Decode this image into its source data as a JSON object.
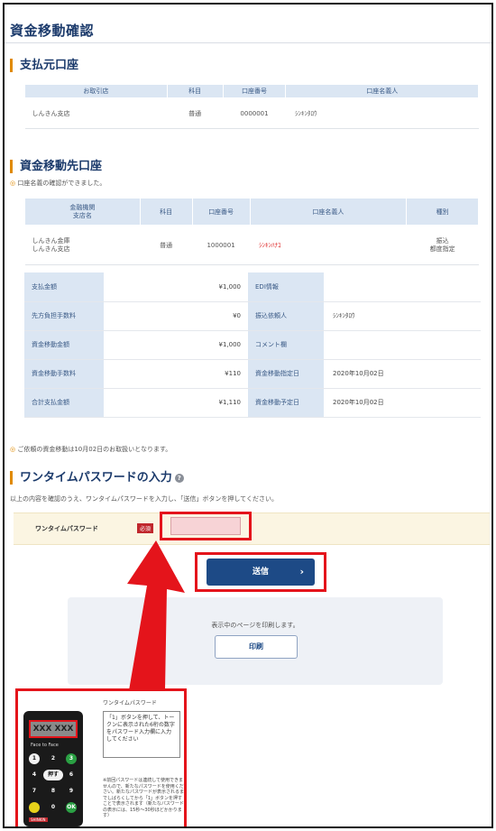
{
  "page": {
    "title": "資金移動確認"
  },
  "source": {
    "title": "支払元口座",
    "headers": [
      "お取引店",
      "科目",
      "口座番号",
      "口座名義人"
    ],
    "row": [
      "しんきん支店",
      "普通",
      "0000001",
      "ｼﾝｷﾝﾀﾛｳ"
    ]
  },
  "dest": {
    "title": "資金移動先口座",
    "notice": "口座名義の確認ができました。",
    "headers": [
      "金融機関\n支店名",
      "科目",
      "口座番号",
      "口座名義人",
      "種別"
    ],
    "row": {
      "bank": "しんきん金庫",
      "branch": "しんきん支店",
      "type": "普通",
      "number": "1000001",
      "name": "ｼﾝｷﾝﾊﾅｺ",
      "kind1": "振込",
      "kind2": "都度指定"
    }
  },
  "amounts": [
    {
      "label": "支払金額",
      "value": "¥1,000",
      "label2": "EDI情報",
      "value2": ""
    },
    {
      "label": "先方負担手数料",
      "value": "¥0",
      "label2": "振込依頼人",
      "value2": "ｼﾝｷﾝﾀﾛｳ"
    },
    {
      "label": "資金移動金額",
      "value": "¥1,000",
      "label2": "コメント欄",
      "value2": ""
    },
    {
      "label": "資金移動手数料",
      "value": "¥110",
      "label2": "資金移動指定日",
      "value2": "2020年10月02日"
    },
    {
      "label": "合計支払金額",
      "value": "¥1,110",
      "label2": "資金移動予定日",
      "value2": "2020年10月02日"
    }
  ],
  "schedule_note": "ご依頼の資金移動は10月02日のお取扱いとなります。",
  "otp": {
    "title": "ワンタイムパスワードの入力",
    "help_icon": "?",
    "instruction": "以上の内容を確認のうえ、ワンタイムパスワードを入力し、「送信」ボタンを押してください。",
    "label": "ワンタイムパスワード",
    "required": "必須",
    "value": ""
  },
  "submit": {
    "label": "送信",
    "chevron": "›"
  },
  "print": {
    "text": "表示中のページを印刷します。",
    "button": "印刷"
  },
  "token": {
    "title": "ワンタイムパスワード",
    "display": "XXX XXX",
    "brand": "Face to Face",
    "push": "押す",
    "ok": "OK",
    "logo": "SHINKIN",
    "instruction": "「1」ボタンを押して、トークンに表示された6桁の数字をパスワード入力欄に入力してください",
    "note": "※前回パスワードは連続して使用できませんので、新たなパスワードを使用ください。新たなパスワードが表示されるまでしばらくしてから「1」ボタンを押すことで表示されます（新たなパスワードの表示には、15秒〜30秒ほどかかります）"
  },
  "colors": {
    "accent": "#e4141b",
    "navy": "#1d4a86",
    "header_bg": "#dbe6f3",
    "orange": "#e08a00"
  }
}
